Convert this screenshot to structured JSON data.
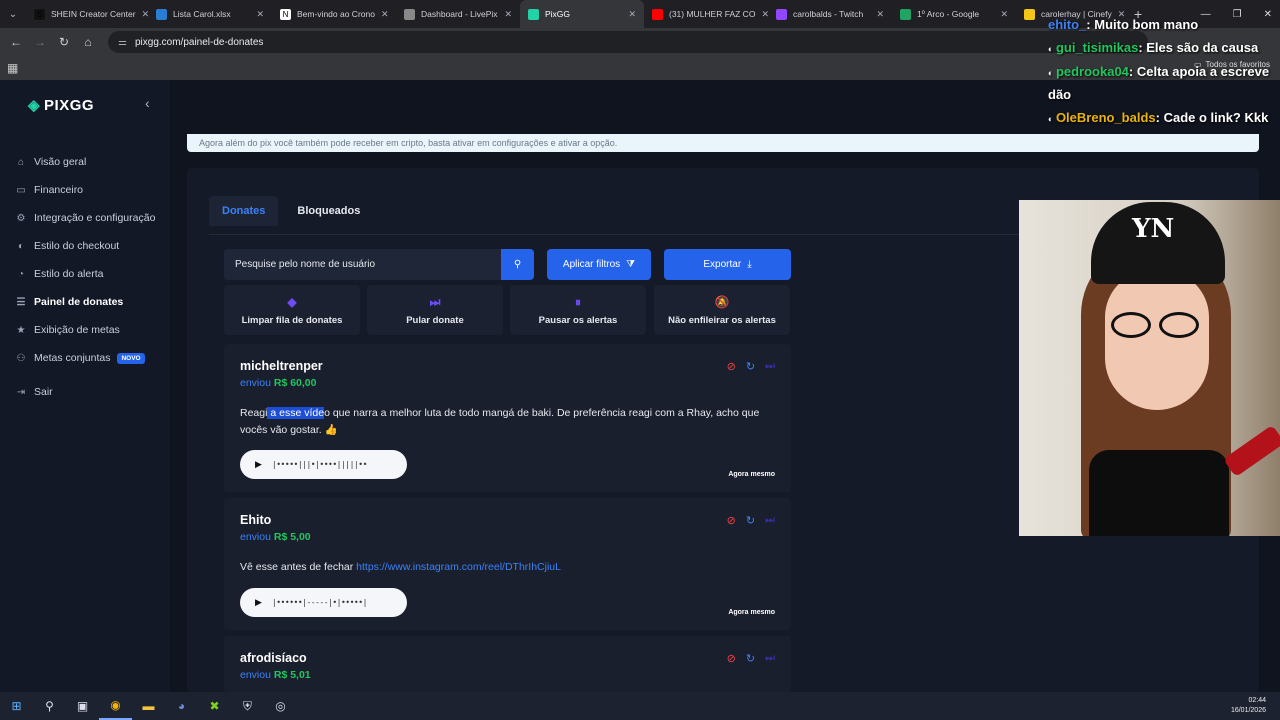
{
  "browser": {
    "tabs": [
      {
        "label": "SHEIN Creator Center",
        "fav": "#111111",
        "favchar": "S",
        "active": false
      },
      {
        "label": "Lista Carol.xlsx",
        "fav": "#2b7cd3",
        "favchar": "",
        "active": false
      },
      {
        "label": "Bem-vindo ao Crono",
        "fav": "#ffffff",
        "favchar": "N",
        "active": false
      },
      {
        "label": "Dashboard - LivePix",
        "fav": "#888888",
        "favchar": "",
        "active": false
      },
      {
        "label": "PixGG",
        "fav": "#22d3a7",
        "favchar": "",
        "active": true
      },
      {
        "label": "(31) MULHER FAZ CO",
        "fav": "#ff0000",
        "favchar": "",
        "active": false
      },
      {
        "label": "carolbalds - Twitch",
        "fav": "#9146ff",
        "favchar": "",
        "active": false
      },
      {
        "label": "1º Arco - Google",
        "fav": "#1fa463",
        "favchar": "",
        "active": false
      },
      {
        "label": "carolerhay | Cinefy",
        "fav": "#f5c518",
        "favchar": "",
        "active": false
      }
    ],
    "url": "pixgg.com/painel-de-donates",
    "bookmarks_folder": "Todos os favoritos"
  },
  "sidebar": {
    "brand": "PIXGG",
    "items": [
      {
        "label": "Visão geral",
        "icon": "home-icon",
        "glyph": "⌂",
        "active": false
      },
      {
        "label": "Financeiro",
        "icon": "wallet-icon",
        "glyph": "▭",
        "active": false
      },
      {
        "label": "Integração e configuração",
        "icon": "gear-icon",
        "glyph": "⚙",
        "active": false
      },
      {
        "label": "Estilo do checkout",
        "icon": "palette-icon",
        "glyph": "◐",
        "active": false
      },
      {
        "label": "Estilo do alerta",
        "icon": "alert-icon",
        "glyph": "◔",
        "active": false
      },
      {
        "label": "Painel de donates",
        "icon": "panel-icon",
        "glyph": "☰",
        "active": true
      },
      {
        "label": "Exibição de metas",
        "icon": "star-icon",
        "glyph": "★",
        "active": false
      },
      {
        "label": "Metas conjuntas",
        "icon": "group-icon",
        "glyph": "⚇",
        "active": false,
        "badge": "NOVO"
      },
      {
        "label": "Sair",
        "icon": "logout-icon",
        "glyph": "⇥",
        "active": false
      }
    ]
  },
  "main": {
    "banner_text": "Agora além do pix você também pode receber em cripto, basta ativar em configurações e ativar a opção.",
    "tabs": [
      {
        "label": "Donates",
        "active": true
      },
      {
        "label": "Bloqueados",
        "active": false
      }
    ],
    "search_placeholder": "Pesquise pelo nome de usuário",
    "filters_label": "Aplicar filtros",
    "export_label": "Exportar",
    "actions": [
      {
        "label": "Limpar fila de donates",
        "icon": "eraser-icon",
        "glyph": "◆"
      },
      {
        "label": "Pular donate",
        "icon": "skip-icon",
        "glyph": "⏭"
      },
      {
        "label": "Pausar os alertas",
        "icon": "pause-icon",
        "glyph": "⏸"
      },
      {
        "label": "Não enfileirar os alertas",
        "icon": "bell-off-icon",
        "glyph": "🔕"
      }
    ],
    "donates": [
      {
        "user": "micheltrenper",
        "sent_label": "enviou",
        "amount": "R$ 60,00",
        "msg_pre": "Reagi",
        "msg_highlight": " a esse víde",
        "msg_post": "o que narra a melhor luta de todo mangá de baki. De preferência reagi com a Rhay, acho que vocês vão gostar. 👍",
        "link": "",
        "time": "Agora mesmo",
        "wave": "|•••••|||•|••••|||||••"
      },
      {
        "user": "Ehito",
        "sent_label": "enviou",
        "amount": "R$ 5,00",
        "msg_pre": "Vê esse antes de fechar ",
        "msg_highlight": "",
        "msg_post": "",
        "link": "https://www.instagram.com/reel/DThrIhCjiuL",
        "time": "Agora mesmo",
        "wave": "|••••••|-----|•|•••••|"
      },
      {
        "user": "afrodisíaco",
        "sent_label": "enviou",
        "amount": "R$ 5,01",
        "msg_pre": "",
        "msg_highlight": "",
        "msg_post": "",
        "link": "",
        "time": "",
        "wave": ""
      }
    ]
  },
  "chat": [
    {
      "user": "ehito_",
      "text": ": Muito bom mano"
    },
    {
      "user": "gui_tisimikas",
      "text": ": Eles são da causa"
    },
    {
      "user": "pedrooka04",
      "text": ": Celta apoia a escreve dão"
    },
    {
      "user": "OleBreno_balds",
      "text": ": Cade o link? Kkk"
    }
  ],
  "webcam": {
    "cap_text": "YN"
  },
  "taskbar": {
    "time": "02:44",
    "date": "16/01/2026"
  },
  "colors": {
    "accent": "#2563eb",
    "brand": "#22d3a7",
    "amount": "#22c55e",
    "ban": "#ef4444"
  }
}
